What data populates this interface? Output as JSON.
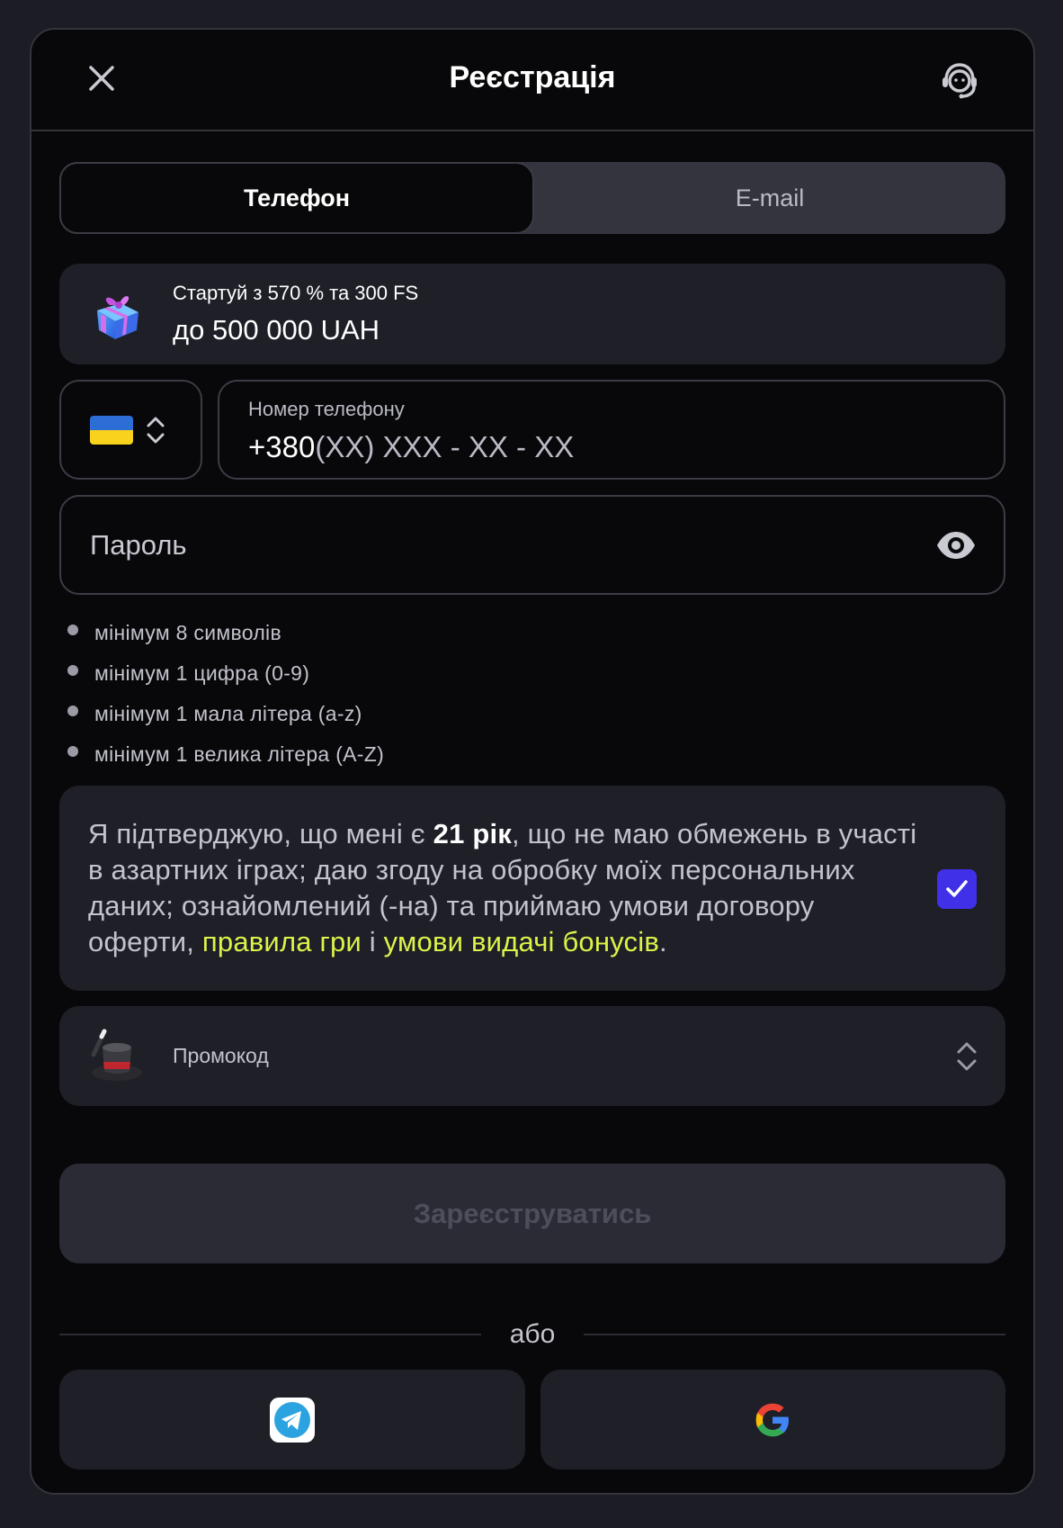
{
  "header": {
    "title": "Реєстрація",
    "close_icon": "close-icon",
    "support_icon": "support-agent-icon"
  },
  "tabs": [
    {
      "label": "Телефон",
      "active": true
    },
    {
      "label": "E-mail",
      "active": false
    }
  ],
  "promo_banner": {
    "icon": "gift-icon",
    "line1": "Стартуй з 570 % та 300 FS",
    "line2": "до 500 000 UAH"
  },
  "phone": {
    "country_flag": "ukraine-flag",
    "label": "Номер телефону",
    "prefix": "+380",
    "mask": "(XX) XXX - XX - XX"
  },
  "password": {
    "placeholder": "Пароль",
    "toggle_icon": "eye-icon"
  },
  "password_rules": [
    "мінімум 8 символів",
    "мінімум 1 цифра (0-9)",
    "мінімум 1 мала літера (a-z)",
    "мінімум 1 велика літера (A-Z)"
  ],
  "consent": {
    "part1": "Я підтверджую, що мені є ",
    "age": "21 рік",
    "part2": ", що не маю обмежень в участі в азартних іграх; даю згоду на обробку моїх персональних даних; ознайомлений (-на) та приймаю умови договору оферти, ",
    "link1": "правила гри",
    "part3": " і ",
    "link2": "умови видачі бонусів",
    "part4": ".",
    "checked": true
  },
  "promo_code": {
    "icon": "magic-hat-icon",
    "label": "Промокод"
  },
  "register_button": "Зареєструватись",
  "divider_text": "або",
  "social": [
    {
      "name": "telegram",
      "icon": "telegram-icon"
    },
    {
      "name": "google",
      "icon": "google-icon"
    }
  ],
  "colors": {
    "background": "#1c1c24",
    "modal": "#08080a",
    "card": "#1e1f27",
    "accent_link": "#ddf24a",
    "checkbox": "#4030e8"
  }
}
